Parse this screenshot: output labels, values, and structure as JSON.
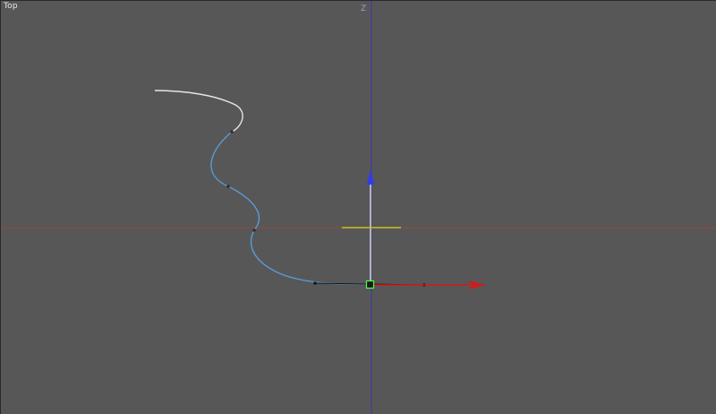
{
  "viewport": {
    "label": "Top",
    "vertical_axis_label": "Z"
  },
  "colors": {
    "background": "#575757",
    "vertical_axis": "#3a3aa8",
    "horizontal_axis": "#9a4a36",
    "spline_selected": "#5a9ad6",
    "spline_unselected": "#e6e6e6",
    "gizmo_x": "#d01c1c",
    "gizmo_z": "#2e3cf0",
    "gizmo_plane": "#c8c018",
    "pivot": "#4cff4c"
  },
  "icons": {
    "pivot_point": "green-square-icon",
    "x_arrow": "red-arrow-icon",
    "z_arrow": "blue-arrow-icon"
  }
}
